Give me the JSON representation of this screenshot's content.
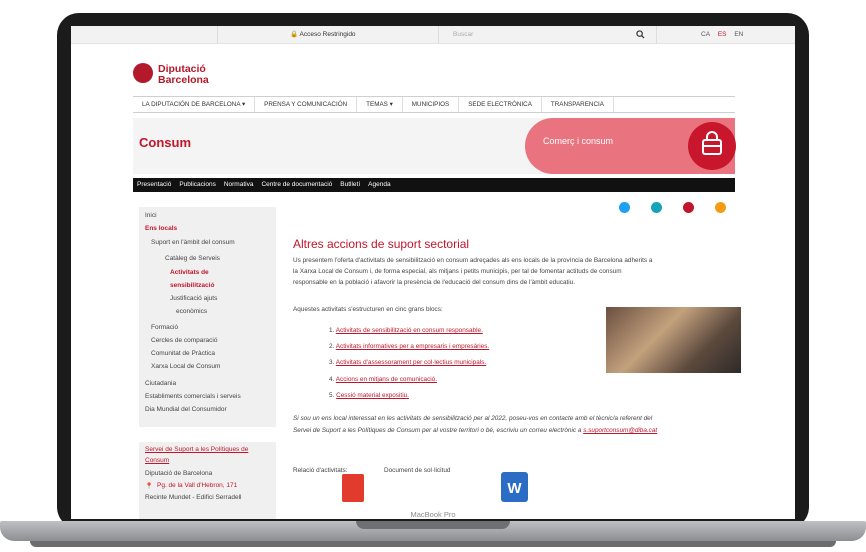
{
  "topbar": {
    "acceso": "Acceso Restringido",
    "search_placeholder": "Buscar",
    "langs": [
      "CA",
      "ES",
      "EN"
    ]
  },
  "logo": {
    "line1": "Diputació",
    "line2": "Barcelona"
  },
  "mainnav": [
    "LA DIPUTACIÓN DE BARCELONA ▾",
    "PRENSA Y COMUNICACIÓN",
    "TEMAS ▾",
    "MUNICIPIOS",
    "SEDE ELECTRÓNICA",
    "TRANSPARENCIA"
  ],
  "banner": {
    "title": "Consum",
    "pill": "Comerç i consum"
  },
  "subnav": [
    "Presentació",
    "Publicacions",
    "Normativa",
    "Centre de documentació",
    "Butlletí",
    "Agenda"
  ],
  "sidebar": {
    "items": [
      {
        "label": "Inici"
      },
      {
        "label": "Ens locals"
      },
      {
        "label": "Suport en l'àmbit del consum"
      },
      {
        "label": "Catàleg de Serveis"
      },
      {
        "label": "Activitats de"
      },
      {
        "label": "sensibilització"
      },
      {
        "label": "Justificació ajuts"
      },
      {
        "label": "econòmics"
      },
      {
        "label": "Formació"
      },
      {
        "label": "Cercles de comparació"
      },
      {
        "label": "Comunitat de Pràctica"
      },
      {
        "label": "Xarxa Local de Consum"
      },
      {
        "label": "Ciutadania"
      },
      {
        "label": "Establiments comercials i serveis"
      },
      {
        "label": "Dia Mundial del Consumidor"
      }
    ],
    "contact": {
      "l1": "Servei de Suport a les Polítiques de",
      "l2": "Consum",
      "l3": "Diputació de Barcelona",
      "l4": "Pg. de la Vall d'Hebron, 171",
      "l5": "Recinte Mundet - Edifici Serradell"
    }
  },
  "content": {
    "title": "Altres accions de suport sectorial",
    "p1a": "Us presentem l'oferta d'activitats de sensibilització en consum adreçades als ens locals de la província de Barcelona adherits a",
    "p1b": "la Xarxa Local de Consum i, de forma especial, als mitjans i petits municipis, per tal de fomentar actituds de consum",
    "p1c": "responsable en la població i afavorir la presència de l'educació del consum dins de l'àmbit educatiu.",
    "p2": "Aquestes activitats s'estructuren en cinc grans blocs:",
    "list": [
      {
        "n": "1.",
        "t": "Activitats de sensibilització en consum responsable."
      },
      {
        "n": "2.",
        "t": "Activitats informatives per a empresaris i empresàries."
      },
      {
        "n": "3.",
        "t": "Activitats d'assessorament per col·lectius municipals."
      },
      {
        "n": "4.",
        "t": "Accions en mitjans de comunicació."
      },
      {
        "n": "5.",
        "t": "Cessió material expositiu."
      }
    ],
    "p3a": "Si sou un ens local interessat en les activitats de sensibilització per al 2022, poseu-vos en contacte amb el tècnic/a referent del",
    "p3b": "Servei de Suport a les Polítiques de Consum per al vostre territori o bé, escriviu un correu electrònic a",
    "email": "s.suportconsum@diba.cat",
    "rel": "Relació d'activitats:",
    "doc": "Document de sol·licitud"
  },
  "device": {
    "label": "MacBook Pro"
  },
  "colors": {
    "accent": "#c0162b",
    "pink": "#e9737f"
  }
}
